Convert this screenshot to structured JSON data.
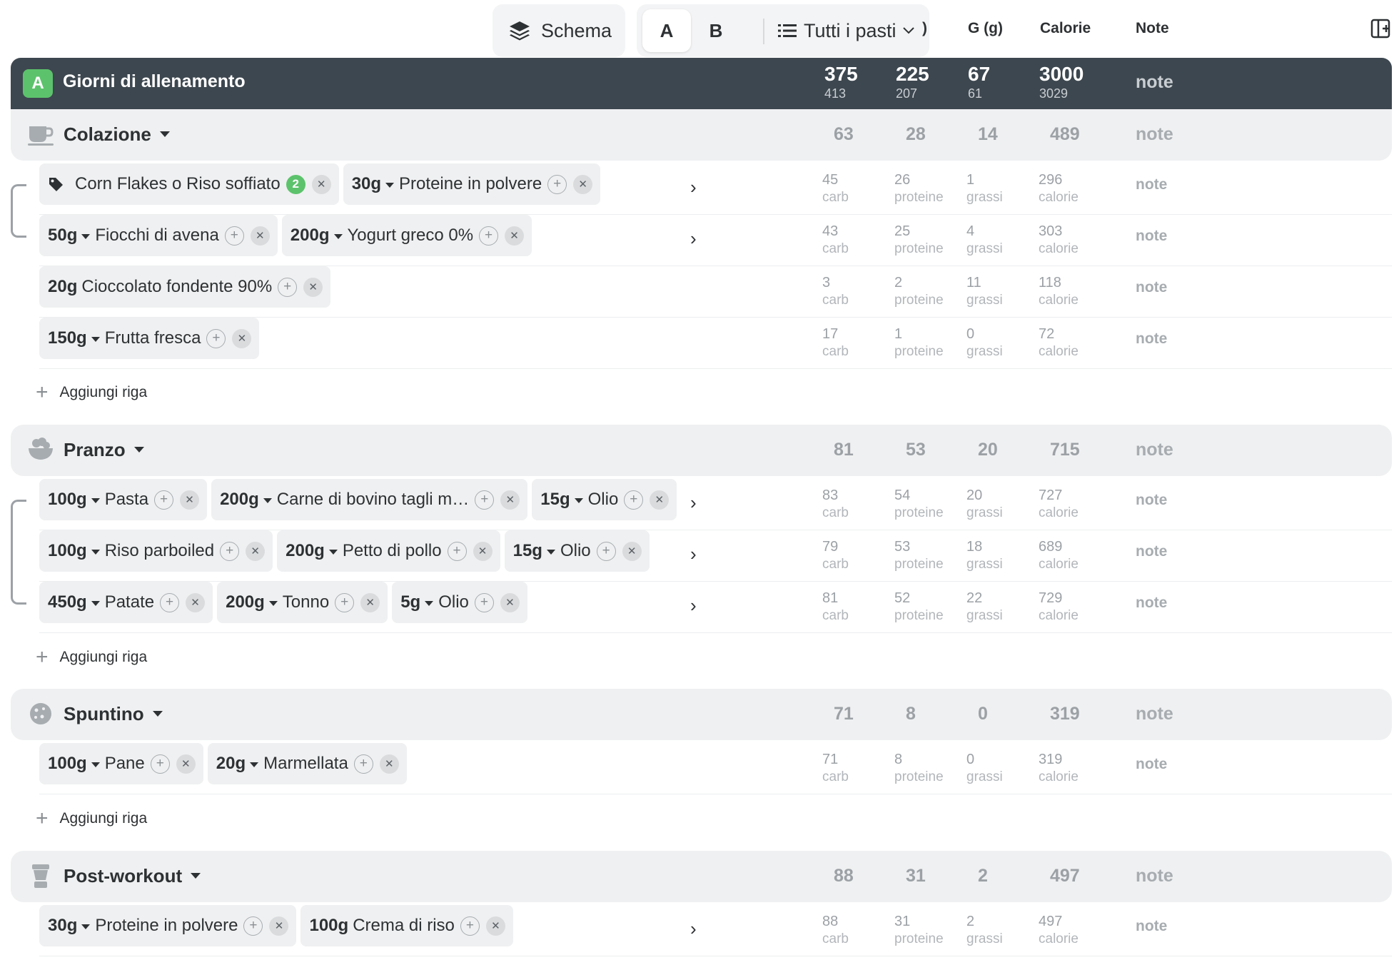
{
  "toolbar": {
    "schema_label": "Schema",
    "variant_a": "A",
    "variant_b": "B",
    "meals_filter": "Tutti i pasti",
    "columns": {
      "protein_tail": ")",
      "fat": "G (g)",
      "calories": "Calorie",
      "note": "Note"
    },
    "icons": {
      "schema": "layers-icon",
      "meals": "list-icon",
      "panel": "panel-add-icon"
    }
  },
  "header": {
    "badge": "A",
    "title": "Giorni di allenamento",
    "totals": [
      {
        "target": "375",
        "actual": "413"
      },
      {
        "target": "225",
        "actual": "207"
      },
      {
        "target": "67",
        "actual": "61"
      },
      {
        "target": "3000",
        "actual": "3029"
      }
    ],
    "note": "note"
  },
  "labels": {
    "carb": "carb",
    "protein": "proteine",
    "fat": "grassi",
    "cal": "calorie",
    "note": "note",
    "add_row": "Aggiungi riga"
  },
  "meals": [
    {
      "name": "Colazione",
      "icon": "coffee-cup-icon",
      "totals": [
        "63",
        "28",
        "14",
        "489"
      ],
      "rows": [
        {
          "chips": [
            {
              "tag": true,
              "name": "Corn Flakes o Riso soffiato",
              "count": "2"
            },
            {
              "qty": "30g",
              "name": "Proteine in polvere"
            }
          ],
          "values": [
            "45",
            "26",
            "1",
            "296"
          ],
          "chevron": true
        },
        {
          "chips": [
            {
              "qty": "50g",
              "name": "Fiocchi di avena"
            },
            {
              "qty": "200g",
              "name": "Yogurt greco 0%"
            }
          ],
          "values": [
            "43",
            "25",
            "4",
            "303"
          ],
          "chevron": true
        },
        {
          "chips": [
            {
              "qty": "20g",
              "name": "Cioccolato fondente 90%",
              "nodd": true
            }
          ],
          "values": [
            "3",
            "2",
            "11",
            "118"
          ],
          "chevron": false
        },
        {
          "chips": [
            {
              "qty": "150g",
              "name": "Frutta fresca"
            }
          ],
          "values": [
            "17",
            "1",
            "0",
            "72"
          ],
          "chevron": false
        }
      ]
    },
    {
      "name": "Pranzo",
      "icon": "salad-bowl-icon",
      "totals": [
        "81",
        "53",
        "20",
        "715"
      ],
      "rows": [
        {
          "chips": [
            {
              "qty": "100g",
              "name": "Pasta"
            },
            {
              "qty": "200g",
              "name": "Carne di bovino tagli m…"
            },
            {
              "qty": "15g",
              "name": "Olio"
            }
          ],
          "values": [
            "83",
            "54",
            "20",
            "727"
          ],
          "chevron": true
        },
        {
          "chips": [
            {
              "qty": "100g",
              "name": "Riso parboiled"
            },
            {
              "qty": "200g",
              "name": "Petto di pollo"
            },
            {
              "qty": "15g",
              "name": "Olio"
            }
          ],
          "values": [
            "79",
            "53",
            "18",
            "689"
          ],
          "chevron": true
        },
        {
          "chips": [
            {
              "qty": "450g",
              "name": "Patate"
            },
            {
              "qty": "200g",
              "name": "Tonno"
            },
            {
              "qty": "5g",
              "name": "Olio"
            }
          ],
          "values": [
            "81",
            "52",
            "22",
            "729"
          ],
          "chevron": true
        }
      ]
    },
    {
      "name": "Spuntino",
      "icon": "cookie-icon",
      "totals": [
        "71",
        "8",
        "0",
        "319"
      ],
      "rows": [
        {
          "chips": [
            {
              "qty": "100g",
              "name": "Pane"
            },
            {
              "qty": "20g",
              "name": "Marmellata"
            }
          ],
          "values": [
            "71",
            "8",
            "0",
            "319"
          ],
          "chevron": false
        }
      ]
    },
    {
      "name": "Post-workout",
      "icon": "blender-icon",
      "totals": [
        "88",
        "31",
        "2",
        "497"
      ],
      "rows": [
        {
          "chips": [
            {
              "qty": "30g",
              "name": "Proteine in polvere"
            },
            {
              "qty": "100g",
              "name": "Crema di riso",
              "nodd": true
            }
          ],
          "values": [
            "88",
            "31",
            "2",
            "497"
          ],
          "chevron": true
        }
      ]
    }
  ]
}
